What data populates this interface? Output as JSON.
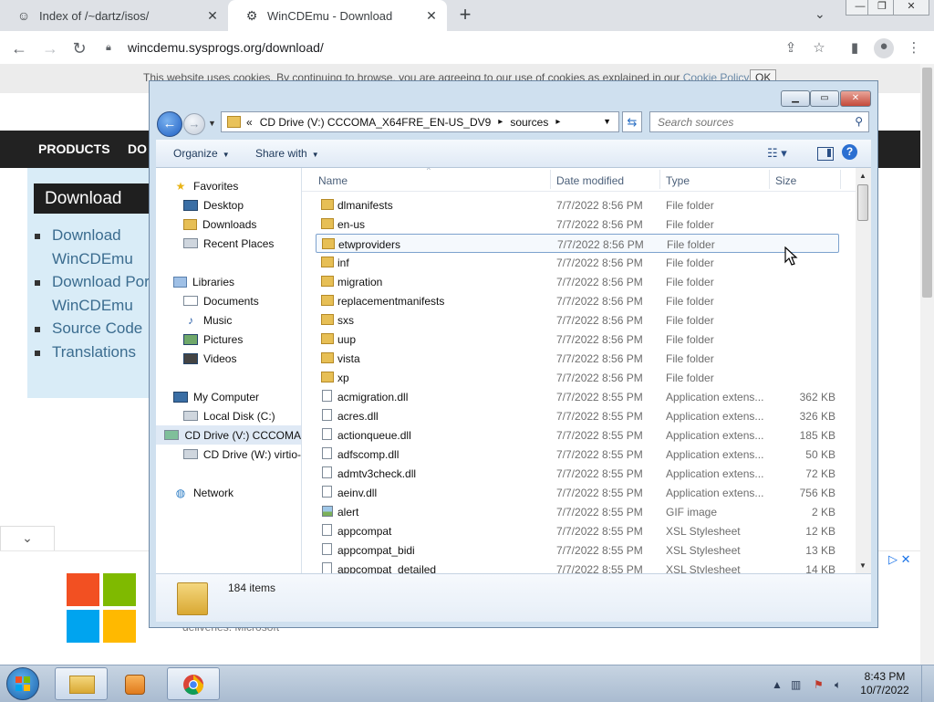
{
  "browser": {
    "tabs": [
      {
        "title": "Index of /~dartz/isos/",
        "close": "✕"
      },
      {
        "title": "WinCDEmu - Download",
        "close": "✕"
      }
    ],
    "new_tab": "+",
    "url": "wincdemu.sysprogs.org/download/",
    "window_controls": {
      "minimize": "—",
      "restore": "❐",
      "close": "✕"
    }
  },
  "page": {
    "cookie_text": "This website uses cookies. By continuing to browse, you are agreeing to our use of cookies as explained in our",
    "cookie_link": "Cookie Policy",
    "cookie_ok": "OK",
    "nav": [
      "PRODUCTS",
      "DO"
    ],
    "download_heading": "Download",
    "download_links": [
      [
        "Download",
        "WinCDEmu"
      ],
      [
        "Download Por",
        "WinCDEmu"
      ],
      [
        "Source Code"
      ],
      [
        "Translations"
      ]
    ],
    "ad_text": "deliveries. Microsoft",
    "brand_colors": [
      "#f25022",
      "#7fba00",
      "#00a4ef",
      "#ffb900"
    ]
  },
  "explorer": {
    "address_prefix": "«",
    "address_segments": [
      "CD Drive (V:) CCCOMA_X64FRE_EN-US_DV9",
      "sources"
    ],
    "search_placeholder": "Search sources",
    "toolbar": {
      "organize": "Organize",
      "share_with": "Share with"
    },
    "nav": {
      "favorites": "Favorites",
      "favorites_items": [
        "Desktop",
        "Downloads",
        "Recent Places"
      ],
      "libraries": "Libraries",
      "libraries_items": [
        "Documents",
        "Music",
        "Pictures",
        "Videos"
      ],
      "computer": "My Computer",
      "computer_items": [
        "Local Disk (C:)",
        "CD Drive (V:) CCCOMA",
        "CD Drive (W:) virtio-"
      ],
      "network": "Network"
    },
    "columns": [
      "Name",
      "Date modified",
      "Type",
      "Size"
    ],
    "files": [
      {
        "name": "dlmanifests",
        "date": "7/7/2022 8:56 PM",
        "type": "File folder",
        "size": "",
        "icon": "folder"
      },
      {
        "name": "en-us",
        "date": "7/7/2022 8:56 PM",
        "type": "File folder",
        "size": "",
        "icon": "folder"
      },
      {
        "name": "etwproviders",
        "date": "7/7/2022 8:56 PM",
        "type": "File folder",
        "size": "",
        "icon": "folder"
      },
      {
        "name": "inf",
        "date": "7/7/2022 8:56 PM",
        "type": "File folder",
        "size": "",
        "icon": "folder"
      },
      {
        "name": "migration",
        "date": "7/7/2022 8:56 PM",
        "type": "File folder",
        "size": "",
        "icon": "folder"
      },
      {
        "name": "replacementmanifests",
        "date": "7/7/2022 8:56 PM",
        "type": "File folder",
        "size": "",
        "icon": "folder"
      },
      {
        "name": "sxs",
        "date": "7/7/2022 8:56 PM",
        "type": "File folder",
        "size": "",
        "icon": "folder"
      },
      {
        "name": "uup",
        "date": "7/7/2022 8:56 PM",
        "type": "File folder",
        "size": "",
        "icon": "folder"
      },
      {
        "name": "vista",
        "date": "7/7/2022 8:56 PM",
        "type": "File folder",
        "size": "",
        "icon": "folder"
      },
      {
        "name": "xp",
        "date": "7/7/2022 8:56 PM",
        "type": "File folder",
        "size": "",
        "icon": "folder"
      },
      {
        "name": "acmigration.dll",
        "date": "7/7/2022 8:55 PM",
        "type": "Application extens...",
        "size": "362 KB",
        "icon": "file"
      },
      {
        "name": "acres.dll",
        "date": "7/7/2022 8:55 PM",
        "type": "Application extens...",
        "size": "326 KB",
        "icon": "file"
      },
      {
        "name": "actionqueue.dll",
        "date": "7/7/2022 8:55 PM",
        "type": "Application extens...",
        "size": "185 KB",
        "icon": "file"
      },
      {
        "name": "adfscomp.dll",
        "date": "7/7/2022 8:55 PM",
        "type": "Application extens...",
        "size": "50 KB",
        "icon": "file"
      },
      {
        "name": "admtv3check.dll",
        "date": "7/7/2022 8:55 PM",
        "type": "Application extens...",
        "size": "72 KB",
        "icon": "file"
      },
      {
        "name": "aeinv.dll",
        "date": "7/7/2022 8:55 PM",
        "type": "Application extens...",
        "size": "756 KB",
        "icon": "file"
      },
      {
        "name": "alert",
        "date": "7/7/2022 8:55 PM",
        "type": "GIF image",
        "size": "2 KB",
        "icon": "gif"
      },
      {
        "name": "appcompat",
        "date": "7/7/2022 8:55 PM",
        "type": "XSL Stylesheet",
        "size": "12 KB",
        "icon": "file"
      },
      {
        "name": "appcompat_bidi",
        "date": "7/7/2022 8:55 PM",
        "type": "XSL Stylesheet",
        "size": "13 KB",
        "icon": "file"
      },
      {
        "name": "appcompat_detailed",
        "date": "7/7/2022 8:55 PM",
        "type": "XSL Stylesheet",
        "size": "14 KB",
        "icon": "file"
      }
    ],
    "hovered_row": 2,
    "item_count": "184 items"
  },
  "taskbar": {
    "time": "8:43 PM",
    "date": "10/7/2022"
  }
}
